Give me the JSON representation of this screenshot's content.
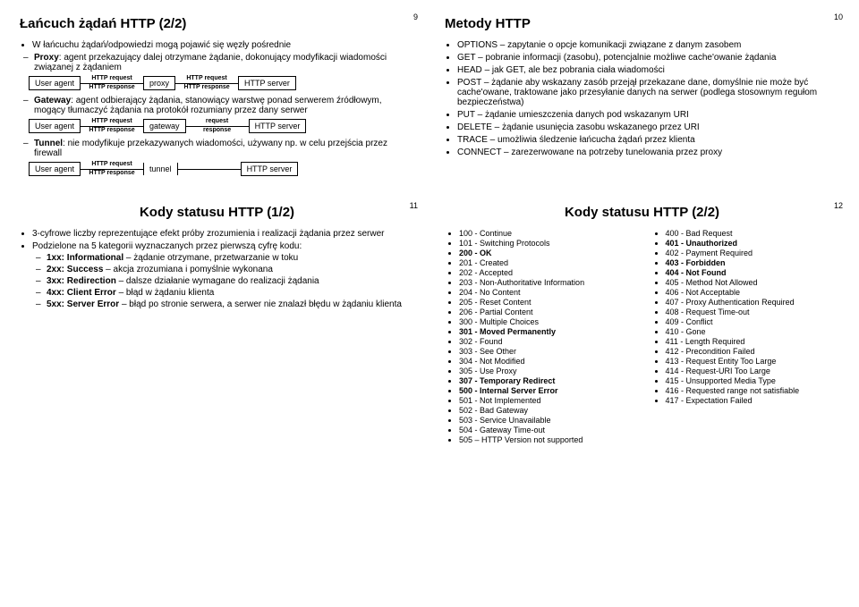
{
  "slides": {
    "s9": {
      "num": "9",
      "title": "Łańcuch żądań HTTP (2/2)",
      "intro": "W łańcuchu żądań/odpowiedzi mogą pojawić się węzły pośrednie",
      "proxy_b": "Proxy",
      "proxy_t": ": agent przekazujący dalej otrzymane żądanie, dokonujący modyfikacji wiadomości związanej z żądaniem",
      "gateway_b": "Gateway",
      "gateway_t": ": agent odbierający żądania, stanowiący warstwę ponad serwerem źródłowym, mogący tłumaczyć żądania na protokół rozumiany przez dany serwer",
      "tunnel_b": "Tunnel",
      "tunnel_t": ": nie modyfikuje przekazywanych wiadomości, używany np. w celu przejścia przez firewall",
      "ua": "User agent",
      "proxy": "proxy",
      "gateway": "gateway",
      "tunnel": "tunnel",
      "server": "HTTP server",
      "hreq": "HTTP request",
      "hresp": "HTTP response",
      "req": "request",
      "resp": "response"
    },
    "s10": {
      "num": "10",
      "title": "Metody HTTP",
      "items": [
        {
          "p": "OPTIONS",
          "t": " – zapytanie o opcje komunikacji związane z danym zasobem"
        },
        {
          "p": "GET",
          "t": " – pobranie informacji (zasobu), potencjalnie możliwe cache'owanie żądania"
        },
        {
          "p": "HEAD",
          "t": " – jak GET, ale bez pobrania ciała wiadomości"
        },
        {
          "p": "POST",
          "t": " – żądanie aby wskazany zasób przejął przekazane dane, domyślnie nie może być cache'owane, traktowane jako przesyłanie danych na serwer (podlega stosownym regułom bezpieczeństwa)"
        },
        {
          "p": "PUT",
          "t": " – żądanie umieszczenia danych pod wskazanym URI"
        },
        {
          "p": "DELETE",
          "t": " – żądanie usunięcia zasobu wskazanego przez URI"
        },
        {
          "p": "TRACE",
          "t": " – umożliwia śledzenie łańcucha żądań przez klienta"
        },
        {
          "p": "CONNECT",
          "t": " – zarezerwowane na potrzeby tunelowania przez proxy"
        }
      ]
    },
    "s11": {
      "num": "11",
      "title": "Kody statusu HTTP (1/2)",
      "b1": "3-cyfrowe liczby reprezentujące efekt próby zrozumienia i realizacji żądania przez serwer",
      "b2": "Podzielone na 5 kategorii wyznaczanych przez pierwszą cyfrę kodu:",
      "cats": [
        {
          "b": "1xx: Informational",
          "t": " – żądanie otrzymane, przetwarzanie w toku"
        },
        {
          "b": "2xx: Success",
          "t": " – akcja zrozumiana i pomyślnie wykonana"
        },
        {
          "b": "3xx: Redirection",
          "t": " – dalsze działanie wymagane do realizacji żądania"
        },
        {
          "b": "4xx: Client Error",
          "t": " – błąd w żądaniu klienta"
        },
        {
          "b": "5xx: Server Error",
          "t": " – błąd po stronie serwera, a serwer nie znalazł błędu w żądaniu klienta"
        }
      ]
    },
    "s12": {
      "num": "12",
      "title": "Kody statusu HTTP (2/2)",
      "col1": [
        {
          "t": "100 - Continue",
          "b": false
        },
        {
          "t": "101 - Switching Protocols",
          "b": false
        },
        {
          "t": "200 - OK",
          "b": true
        },
        {
          "t": "201 - Created",
          "b": false
        },
        {
          "t": "202 - Accepted",
          "b": false
        },
        {
          "t": "203 - Non-Authoritative Information",
          "b": false
        },
        {
          "t": "204 - No Content",
          "b": false
        },
        {
          "t": "205 - Reset Content",
          "b": false
        },
        {
          "t": "206 - Partial Content",
          "b": false
        },
        {
          "t": "300 - Multiple Choices",
          "b": false
        },
        {
          "t": "301 - Moved Permanently",
          "b": true
        },
        {
          "t": "302 - Found",
          "b": false
        },
        {
          "t": "303 - See Other",
          "b": false
        },
        {
          "t": "304 - Not Modified",
          "b": false
        },
        {
          "t": "305 - Use Proxy",
          "b": false
        },
        {
          "t": "307 - Temporary Redirect",
          "b": true
        },
        {
          "t": "500 -  Internal Server Error",
          "b": true
        },
        {
          "t": "501 -  Not Implemented",
          "b": false
        },
        {
          "t": "502 -  Bad Gateway",
          "b": false
        },
        {
          "t": "503 -  Service Unavailable",
          "b": false
        },
        {
          "t": "504 -  Gateway Time-out",
          "b": false
        },
        {
          "t": "505 – HTTP Version not supported",
          "b": false
        }
      ],
      "col2": [
        {
          "t": "400 - Bad Request",
          "b": false
        },
        {
          "t": "401 - Unauthorized",
          "b": true
        },
        {
          "t": "402 - Payment Required",
          "b": false
        },
        {
          "t": "403 - Forbidden",
          "b": true
        },
        {
          "t": "404 - Not Found",
          "b": true
        },
        {
          "t": "405 - Method Not Allowed",
          "b": false
        },
        {
          "t": "406 - Not Acceptable",
          "b": false
        },
        {
          "t": "407 -  Proxy Authentication Required",
          "b": false
        },
        {
          "t": "408 -  Request Time-out",
          "b": false
        },
        {
          "t": "409 -  Conflict",
          "b": false
        },
        {
          "t": "410 -  Gone",
          "b": false
        },
        {
          "t": "411 -  Length Required",
          "b": false
        },
        {
          "t": "412 -  Precondition Failed",
          "b": false
        },
        {
          "t": "413 -  Request Entity Too Large",
          "b": false
        },
        {
          "t": "414 -  Request-URI Too Large",
          "b": false
        },
        {
          "t": "415 -  Unsupported Media Type",
          "b": false
        },
        {
          "t": "416 -  Requested range not satisfiable",
          "b": false
        },
        {
          "t": "417 -  Expectation Failed",
          "b": false
        }
      ]
    }
  }
}
